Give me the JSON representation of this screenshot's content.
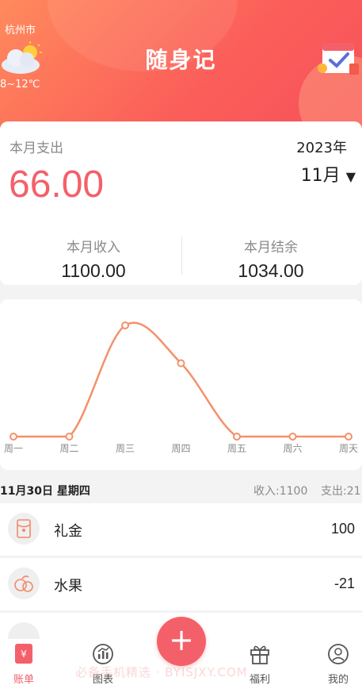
{
  "header": {
    "city": "杭州市",
    "temperature": "8~12℃",
    "title": "随身记"
  },
  "summary": {
    "expense_label": "本月支出",
    "expense_value": "66.00",
    "year": "2023年",
    "month": "11月",
    "month_caret": "▼",
    "income_label": "本月收入",
    "income_value": "1100.00",
    "balance_label": "本月结余",
    "balance_value": "1034.00"
  },
  "chart_data": {
    "type": "line",
    "categories": [
      "周一",
      "周二",
      "周三",
      "周四",
      "周五",
      "周六",
      "周天"
    ],
    "values": [
      0,
      0,
      100,
      66,
      0,
      0,
      0
    ],
    "ylim": [
      0,
      100
    ],
    "grid": false,
    "color": "#f4906a"
  },
  "day": {
    "date": "11月30日 星期四",
    "income": "收入:1100",
    "expense": "支出:21"
  },
  "transactions": [
    {
      "name": "礼金",
      "amount": "100",
      "icon": "red-envelope-icon"
    },
    {
      "name": "水果",
      "amount": "-21",
      "icon": "fruit-icon"
    }
  ],
  "tabs": [
    {
      "label": "账单",
      "icon": "bill-icon",
      "active": true
    },
    {
      "label": "图表",
      "icon": "chart-icon",
      "active": false
    },
    {
      "label": "福利",
      "icon": "gift-icon",
      "active": false
    },
    {
      "label": "我的",
      "icon": "user-icon",
      "active": false
    }
  ],
  "fab": {
    "label": "+"
  },
  "watermark": "必备手机精选 · BYISJXY.COM",
  "colors": {
    "accent": "#f4606a",
    "header_start": "#ff8a5c",
    "header_end": "#f6505a"
  }
}
